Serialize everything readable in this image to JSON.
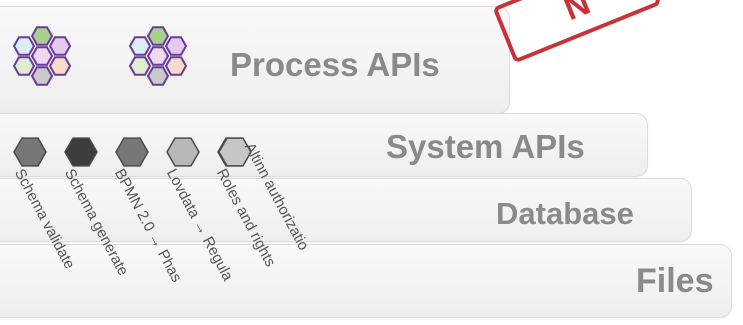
{
  "layers": {
    "process": "Process APIs",
    "system": "System APIs",
    "database": "Database",
    "files": "Files"
  },
  "services": [
    {
      "label": "Schema validate",
      "color": "#777777"
    },
    {
      "label": "Schema generate",
      "color": "#3d3d3d"
    },
    {
      "label": "BPMN 2.0 → Phas",
      "color": "#777777"
    },
    {
      "label": "Lovdata → Regula",
      "color": "#b8b8b8"
    },
    {
      "label": "Roles and rights",
      "color": "#c6c6c6"
    },
    {
      "label": "Altinn authorizatio",
      "color": "#c6c6c6"
    }
  ],
  "stamp": {
    "text": "N"
  },
  "colors": {
    "hex_stroke": "#6a3a9a",
    "layer_text": "#8a8a8a",
    "stamp": "#c21d24"
  }
}
